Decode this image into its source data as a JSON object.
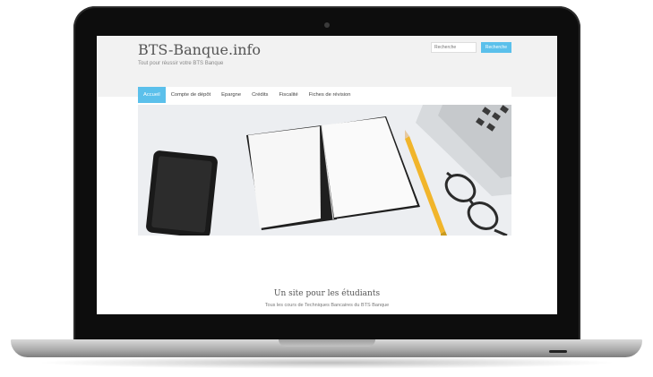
{
  "site": {
    "title": "BTS-Banque.info",
    "tagline": "Tout pour réussir votre BTS Banque"
  },
  "search": {
    "placeholder": "Recherche",
    "button_label": "Recherche"
  },
  "nav": {
    "items": [
      {
        "label": "Accueil",
        "active": true
      },
      {
        "label": "Compte de dépôt",
        "active": false
      },
      {
        "label": "Epargne",
        "active": false
      },
      {
        "label": "Crédits",
        "active": false
      },
      {
        "label": "Fiscalité",
        "active": false
      },
      {
        "label": "Fiches de révision",
        "active": false
      }
    ]
  },
  "hero": {
    "description": "",
    "icons": [
      "smartphone-icon",
      "notebook-icon",
      "pencil-icon",
      "glasses-icon",
      "laptop-icon"
    ]
  },
  "main": {
    "section_title": "Un site pour les étudiants",
    "section_subtitle": "Tous les cours de Techniques Bancaires du BTS Banque"
  },
  "colors": {
    "accent": "#5bc0eb",
    "header_bg": "#f2f2f2",
    "laptop_bezel": "#0d0d0d",
    "laptop_base": "#b4b4b4"
  }
}
